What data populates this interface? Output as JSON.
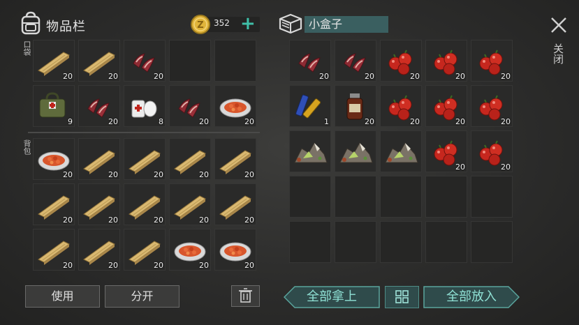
{
  "inventory": {
    "title": "物品栏",
    "coins": "352",
    "pocket_label": "口袋",
    "backpack_label": "背包",
    "pocket_slots": [
      {
        "item": "wood-plank-icon",
        "count": "20"
      },
      {
        "item": "wood-plank-icon",
        "count": "20"
      },
      {
        "item": "raw-meat-icon",
        "count": "20"
      },
      {
        "item": "",
        "count": ""
      },
      {
        "item": "",
        "count": ""
      },
      {
        "item": "medical-bag-icon",
        "count": "9"
      },
      {
        "item": "raw-meat-icon",
        "count": "20"
      },
      {
        "item": "bandage-icon",
        "count": "8"
      },
      {
        "item": "raw-meat-icon",
        "count": "20"
      },
      {
        "item": "cooked-dish-icon",
        "count": "20"
      }
    ],
    "backpack_slots": [
      {
        "item": "cooked-dish-icon",
        "count": "20"
      },
      {
        "item": "wood-plank-icon",
        "count": "20"
      },
      {
        "item": "wood-plank-icon",
        "count": "20"
      },
      {
        "item": "wood-plank-icon",
        "count": "20"
      },
      {
        "item": "wood-plank-icon",
        "count": "20"
      },
      {
        "item": "wood-plank-icon",
        "count": "20"
      },
      {
        "item": "wood-plank-icon",
        "count": "20"
      },
      {
        "item": "wood-plank-icon",
        "count": "20"
      },
      {
        "item": "wood-plank-icon",
        "count": "20"
      },
      {
        "item": "wood-plank-icon",
        "count": "20"
      },
      {
        "item": "wood-plank-icon",
        "count": "20"
      },
      {
        "item": "wood-plank-icon",
        "count": "20"
      },
      {
        "item": "wood-plank-icon",
        "count": "20"
      },
      {
        "item": "cooked-dish-icon",
        "count": "20"
      },
      {
        "item": "cooked-dish-icon",
        "count": "20"
      }
    ]
  },
  "container": {
    "title": "小盒子",
    "slots": [
      {
        "item": "raw-meat-icon",
        "count": "20"
      },
      {
        "item": "raw-meat-icon",
        "count": "20"
      },
      {
        "item": "berries-icon",
        "count": "20"
      },
      {
        "item": "berries-icon",
        "count": "20"
      },
      {
        "item": "berries-icon",
        "count": "20"
      },
      {
        "item": "battery-icon",
        "count": "1"
      },
      {
        "item": "medicine-bottle-icon",
        "count": "20"
      },
      {
        "item": "berries-icon",
        "count": "20"
      },
      {
        "item": "berries-icon",
        "count": "20"
      },
      {
        "item": "berries-icon",
        "count": "20"
      },
      {
        "item": "ore-pile-icon",
        "count": ""
      },
      {
        "item": "ore-pile-icon",
        "count": ""
      },
      {
        "item": "ore-pile-icon",
        "count": ""
      },
      {
        "item": "berries-icon",
        "count": "20"
      },
      {
        "item": "berries-icon",
        "count": "20"
      },
      {
        "item": "",
        "count": ""
      },
      {
        "item": "",
        "count": ""
      },
      {
        "item": "",
        "count": ""
      },
      {
        "item": "",
        "count": ""
      },
      {
        "item": "",
        "count": ""
      },
      {
        "item": "",
        "count": ""
      },
      {
        "item": "",
        "count": ""
      },
      {
        "item": "",
        "count": ""
      },
      {
        "item": "",
        "count": ""
      },
      {
        "item": "",
        "count": ""
      }
    ]
  },
  "buttons": {
    "use": "使用",
    "split": "分开",
    "take_all": "全部拿上",
    "put_all": "全部放入",
    "close": "关闭"
  },
  "colors": {
    "accent_teal": "#3fbfa8",
    "container_title_bg": "#3a5f60",
    "coin_gold": "#e0b43a"
  }
}
